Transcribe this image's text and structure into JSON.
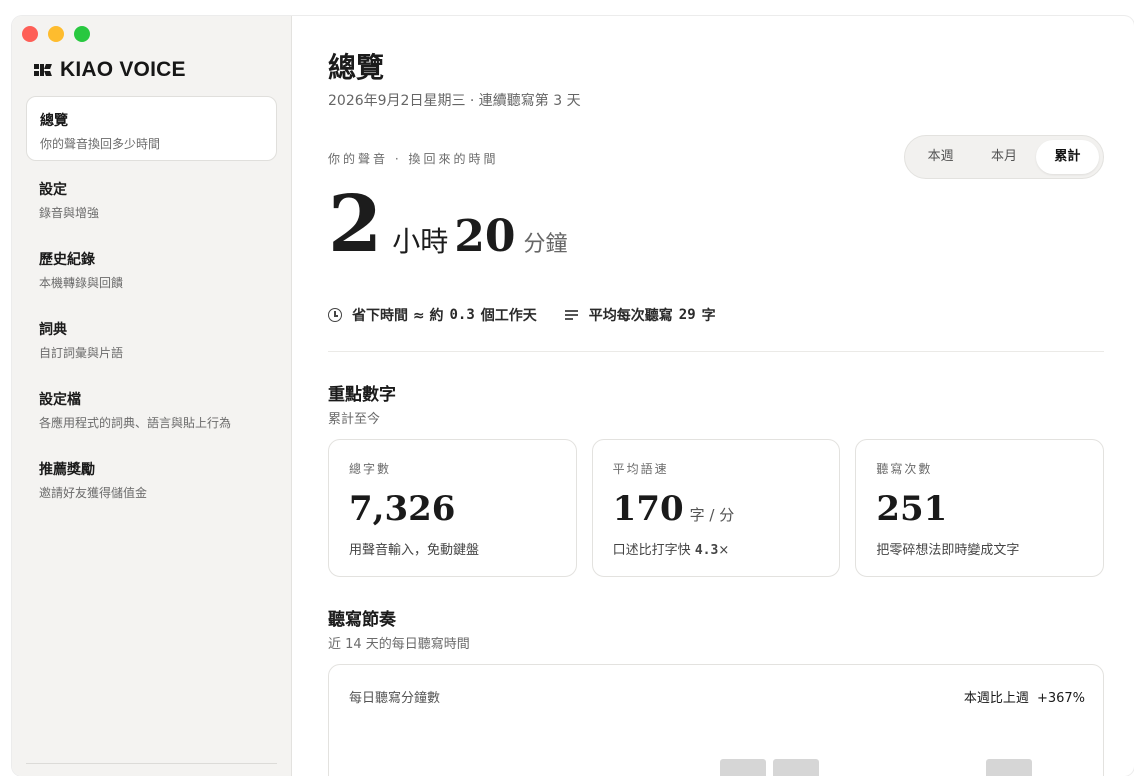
{
  "app": {
    "logo": "KIAO VOICE"
  },
  "sidebar": {
    "items": [
      {
        "title": "總覽",
        "sub": "你的聲音換回多少時間",
        "active": true
      },
      {
        "title": "設定",
        "sub": "錄音與增強"
      },
      {
        "title": "歷史紀錄",
        "sub": "本機轉錄與回饋"
      },
      {
        "title": "詞典",
        "sub": "自訂詞彙與片語"
      },
      {
        "title": "設定檔",
        "sub": "各應用程式的詞典、語言與貼上行為"
      },
      {
        "title": "推薦獎勵",
        "sub": "邀請好友獲得儲值金"
      }
    ]
  },
  "main": {
    "title": "總覽",
    "date": "2026年9月2日星期三 · 連續聽寫第 3 天",
    "voice_label": "你的聲音 · 換回來的時間",
    "range_options": [
      "本週",
      "本月",
      "累計"
    ],
    "range_selected": "累計",
    "time_saved": {
      "hours": "2",
      "hours_unit": "小時",
      "minutes": "20",
      "minutes_unit": "分鐘"
    },
    "meta": {
      "saved_prefix": "省下時間 ≈ 約",
      "saved_value": "0.3",
      "saved_suffix": "個工作天",
      "avg_prefix": "平均每次聽寫",
      "avg_value": "29",
      "avg_suffix": "字"
    },
    "key_numbers": {
      "title": "重點數字",
      "sub": "累計至今",
      "cards": [
        {
          "label": "總字數",
          "value": "7,326",
          "unit": "",
          "note": "用聲音輸入，免動鍵盤"
        },
        {
          "label": "平均語速",
          "value": "170",
          "unit": "字 / 分",
          "note_prefix": "口述比打字快",
          "note_value": "4.3",
          "note_suffix": "×"
        },
        {
          "label": "聽寫次數",
          "value": "251",
          "unit": "",
          "note": "把零碎想法即時變成文字"
        }
      ]
    },
    "rhythm": {
      "title": "聽寫節奏",
      "sub": "近 14 天的每日聽寫時間",
      "chart_title": "每日聽寫分鐘數",
      "compare_label": "本週比上週",
      "compare_value": "+367%"
    }
  },
  "colors": {
    "sidebar_bg": "#f4f3f1",
    "bar": "#d6d6d6",
    "traffic_red": "#fe5f57",
    "traffic_yellow": "#febc2e",
    "traffic_green": "#28c840"
  }
}
